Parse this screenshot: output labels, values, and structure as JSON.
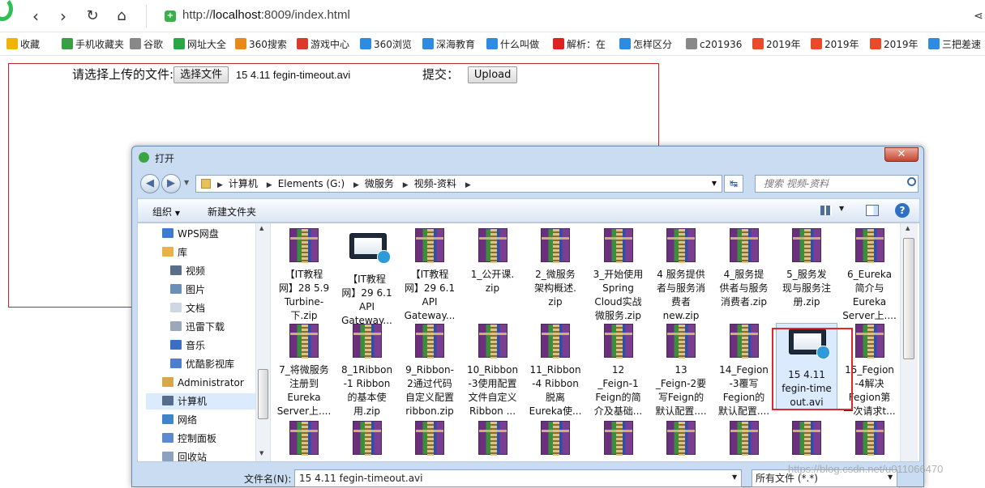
{
  "browser": {
    "url_prefix": "http://",
    "url_host": "localhost",
    "url_rest": ":8009/index.html",
    "bookmarks": [
      "收藏",
      "手机收藏夹",
      "谷歌",
      "网址大全",
      "360搜索",
      "游戏中心",
      "360浏览",
      "深海教育",
      "什么叫做",
      "解析：在",
      "怎样区分",
      "c201936",
      "2019年",
      "2019年",
      "2019年",
      "三把差速"
    ]
  },
  "form": {
    "file_label": "请选择上传的文件:",
    "choose_button": "选择文件",
    "chosen_file": "15 4.11 fegin-timeout.avi",
    "submit_label": "提交：",
    "upload_button": "Upload"
  },
  "dialog": {
    "title": "打开",
    "close": "✕",
    "breadcrumb": [
      "计算机",
      "Elements (G:)",
      "微服务",
      "视频-资料"
    ],
    "search_placeholder": "搜索 视频-资料",
    "organize": "组织",
    "new_folder": "新建文件夹",
    "nav_items": [
      {
        "label": "WPS网盘",
        "color": "#3d7ad1"
      },
      {
        "label": "库",
        "color": "#e8b14a"
      },
      {
        "label": "视频",
        "color": "#5a6e8a"
      },
      {
        "label": "图片",
        "color": "#6a8fb8"
      },
      {
        "label": "文档",
        "color": "#cfd7e2"
      },
      {
        "label": "迅雷下载",
        "color": "#9aa8ba"
      },
      {
        "label": "音乐",
        "color": "#3c6fc4"
      },
      {
        "label": "优酷影视库",
        "color": "#4d7fd0"
      },
      {
        "label": "Administrator",
        "color": "#d6a848"
      },
      {
        "label": "计算机",
        "color": "#556c8c"
      },
      {
        "label": "网络",
        "color": "#3f85c9"
      },
      {
        "label": "控制面板",
        "color": "#5b8ad0"
      },
      {
        "label": "回收站",
        "color": "#8aa2bf"
      }
    ],
    "files_row1": [
      {
        "type": "rar",
        "lines": [
          "【IT教程",
          "网】28 5.9",
          "Turbine-",
          "下.zip"
        ]
      },
      {
        "type": "video",
        "lines": [
          "【IT教程",
          "网】29 6.1",
          "API",
          "Gateway..."
        ]
      },
      {
        "type": "rar",
        "lines": [
          "【IT教程",
          "网】29 6.1",
          "API",
          "Gateway..."
        ]
      },
      {
        "type": "rar",
        "lines": [
          "1_公开课.",
          "zip"
        ]
      },
      {
        "type": "rar",
        "lines": [
          "2_微服务",
          "架构概述.",
          "zip"
        ]
      },
      {
        "type": "rar",
        "lines": [
          "3_开始使用",
          "Spring",
          "Cloud实战",
          "微服务.zip"
        ]
      },
      {
        "type": "rar",
        "lines": [
          "4 服务提供",
          "者与服务消",
          "费者",
          "new.zip"
        ]
      },
      {
        "type": "rar",
        "lines": [
          "4_服务提",
          "供者与服务",
          "消费者.zip"
        ]
      },
      {
        "type": "rar",
        "lines": [
          "5_服务发",
          "现与服务注",
          "册.zip"
        ]
      },
      {
        "type": "rar",
        "lines": [
          "6_Eureka",
          "简介与",
          "Eureka",
          "Server上...."
        ]
      }
    ],
    "files_row2": [
      {
        "type": "rar",
        "lines": [
          "7_将微服务",
          "注册到",
          "Eureka",
          "Server上...."
        ]
      },
      {
        "type": "rar",
        "lines": [
          "8_1Ribbon",
          "-1 Ribbon",
          "的基本使",
          "用.zip"
        ]
      },
      {
        "type": "rar",
        "lines": [
          "9_Ribbon-",
          "2通过代码",
          "自定义配置",
          "ribbon.zip"
        ]
      },
      {
        "type": "rar",
        "lines": [
          "10_Ribbon",
          "-3使用配置",
          "文件自定义",
          "Ribbon ..."
        ]
      },
      {
        "type": "rar",
        "lines": [
          "11_Ribbon",
          "-4 Ribbon",
          "脱离",
          "Eureka使..."
        ]
      },
      {
        "type": "rar",
        "lines": [
          "12",
          "_Feign-1",
          "Feign的简",
          "介及基础..."
        ]
      },
      {
        "type": "rar",
        "lines": [
          "13",
          "_Feign-2要",
          "写Feign的",
          "默认配置...."
        ]
      },
      {
        "type": "rar",
        "lines": [
          "14_Fegion",
          "-3覆写",
          "Fegion的",
          "默认配置...."
        ]
      },
      {
        "type": "video",
        "lines": [
          "15 4.11",
          "fegin-time",
          "out.avi"
        ],
        "selected": true
      },
      {
        "type": "rar",
        "lines": [
          "15_Fegion",
          "-4解决",
          "Fegion第",
          "一次请求t..."
        ]
      }
    ],
    "filename_label": "文件名(N):",
    "filename_value": "15 4.11 fegin-timeout.avi",
    "filetype_value": "所有文件 (*.*)"
  },
  "watermark": "https://blog.csdn.net/u011066470"
}
